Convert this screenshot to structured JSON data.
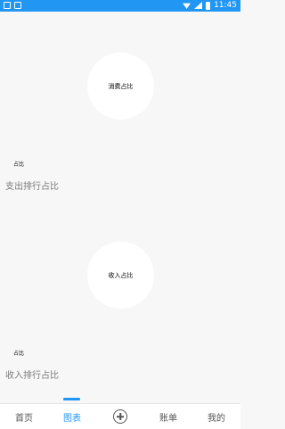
{
  "status_bar": {
    "time": "11:45",
    "icons_left": [
      "notification-icon",
      "photo-icon"
    ],
    "icons_right": [
      "wifi-icon",
      "signal-icon",
      "battery-icon"
    ],
    "background": "#2196f3"
  },
  "charts": [
    {
      "center_label": "消费占比",
      "legend_label": "占比",
      "section_title": "支出排行占比"
    },
    {
      "center_label": "收入占比",
      "legend_label": "占比",
      "section_title": "收入排行占比"
    }
  ],
  "bottom_nav": {
    "items": [
      {
        "label": "首页"
      },
      {
        "label": "图表",
        "active": true
      },
      {
        "label": "",
        "icon": "add-circle-icon"
      },
      {
        "label": "账单"
      },
      {
        "label": "我的"
      }
    ],
    "active_color": "#2196f3"
  }
}
